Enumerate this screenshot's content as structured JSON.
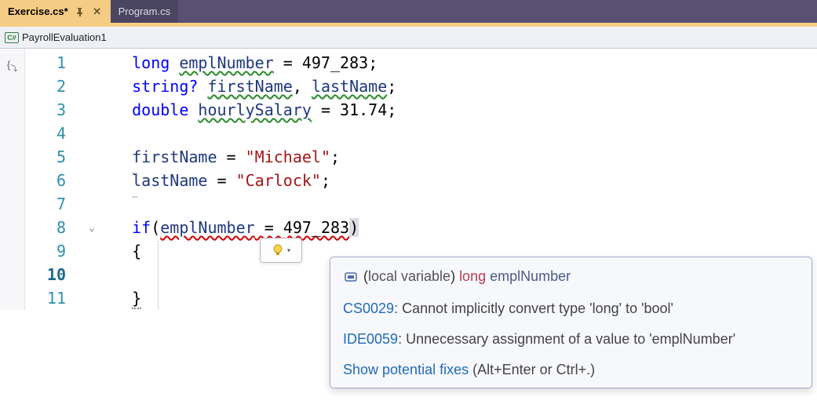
{
  "tabs": {
    "active": {
      "label": "Exercise.cs*"
    },
    "inactive": {
      "label": "Program.cs"
    }
  },
  "navigation": {
    "badge": "C#",
    "context": "PayrollEvaluation1"
  },
  "gutter": {
    "lines": [
      "1",
      "2",
      "3",
      "4",
      "5",
      "6",
      "7",
      "8",
      "9",
      "10",
      "11"
    ],
    "currentLine": "10"
  },
  "code": {
    "l1": {
      "kw": "long",
      "ident": "emplNumber",
      "eq": " = ",
      "val": "497_283",
      "end": ";"
    },
    "l2": {
      "kw": "string",
      "q": "?",
      "sp": " ",
      "id1": "firstName",
      "comma": ", ",
      "id2": "lastName",
      "end": ";"
    },
    "l3": {
      "kw": "double",
      "ident": "hourlySalary",
      "eq": " = ",
      "val": "31.74",
      "end": ";"
    },
    "l5": {
      "ident": "firstName",
      "eq": " = ",
      "val": "\"Michael\"",
      "end": ";"
    },
    "l6": {
      "ident": "lastName",
      "eq": " = ",
      "val": "\"Carlock\"",
      "end": ";"
    },
    "l8": {
      "kw": "if",
      "open": "(",
      "ident": "emplNumber",
      "eq": " = ",
      "val": "497_283",
      "close": ")"
    },
    "l9": {
      "brace": "{"
    },
    "l11": {
      "brace": "}"
    }
  },
  "tooltip": {
    "header": {
      "paren": "(",
      "localvar": "local variable",
      "paren2": ") ",
      "type": "long",
      "sp": " ",
      "name": "emplNumber"
    },
    "diag1": {
      "code": "CS0029",
      "msg": ": Cannot implicitly convert type 'long' to 'bool'"
    },
    "diag2": {
      "code": "IDE0059",
      "msg": ": Unnecessary assignment of a value to 'emplNumber'"
    },
    "fix": {
      "link": "Show potential fixes",
      "keys": " (Alt+Enter or Ctrl+.)"
    }
  }
}
